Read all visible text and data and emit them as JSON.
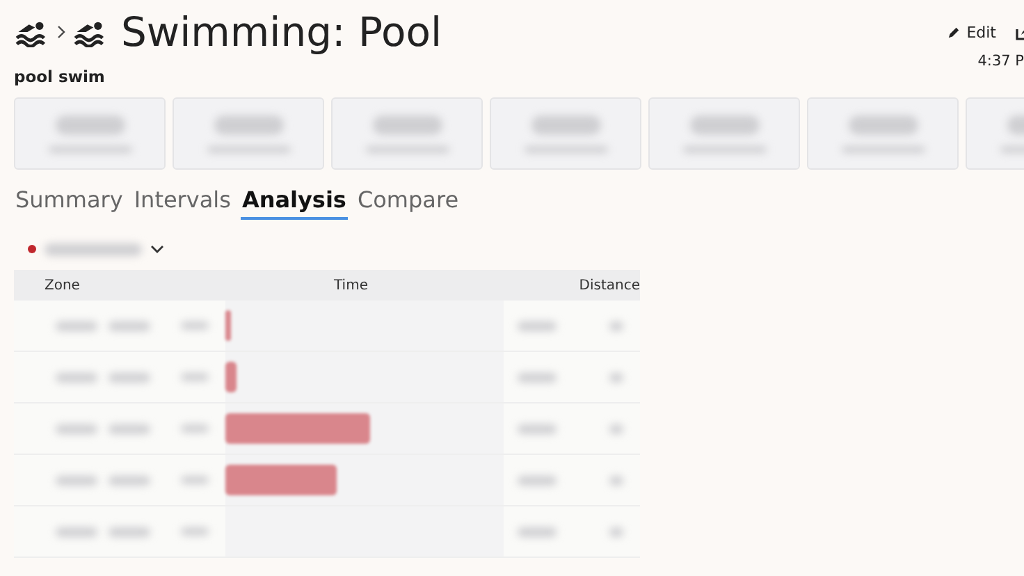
{
  "header": {
    "title": "Swimming: Pool",
    "subtitle": "pool swim",
    "edit_label": "Edit",
    "time": "4:37 P"
  },
  "stat_cards": [
    {
      "kind": "blurred"
    },
    {
      "kind": "blurred"
    },
    {
      "kind": "blurred"
    },
    {
      "kind": "blurred"
    },
    {
      "kind": "blurred"
    },
    {
      "kind": "blurred"
    },
    {
      "kind": "blurred"
    }
  ],
  "tabs": [
    {
      "label": "Summary",
      "selected": false
    },
    {
      "label": "Intervals",
      "selected": false
    },
    {
      "label": "Analysis",
      "selected": true
    },
    {
      "label": "Compare",
      "selected": false
    }
  ],
  "selector": {
    "color": "#c0272d"
  },
  "table": {
    "columns": [
      "Zone",
      "Time",
      "Distance"
    ],
    "rows": [
      {
        "kind": "bar",
        "level": 0.02
      },
      {
        "kind": "bar",
        "level": 0.04
      },
      {
        "kind": "bar",
        "level": 0.52
      },
      {
        "kind": "bar",
        "level": 0.4
      },
      {
        "kind": "empty"
      }
    ]
  }
}
